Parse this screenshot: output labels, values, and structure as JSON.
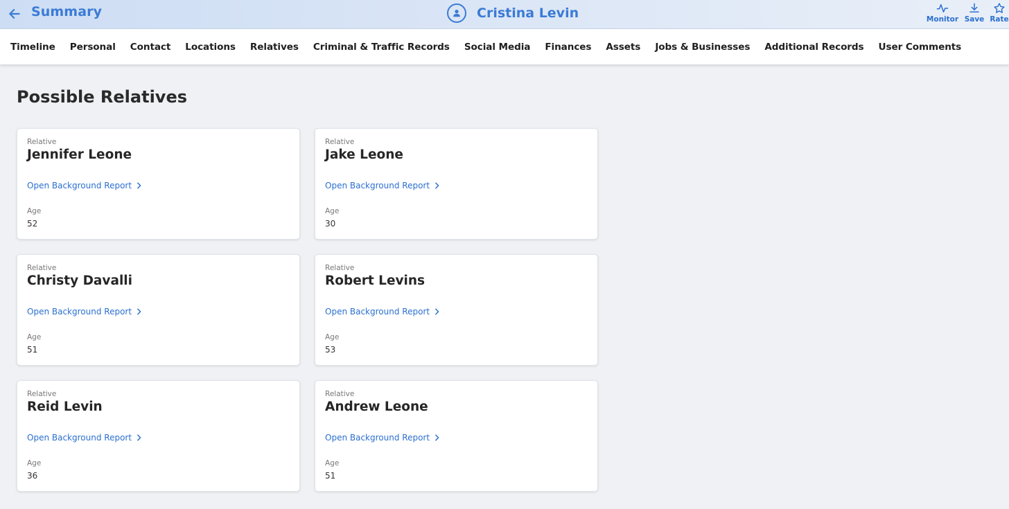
{
  "header": {
    "back_label": "Summary",
    "person_name": "Cristina Levin",
    "actions": [
      {
        "label": "Monitor",
        "icon": "activity-icon"
      },
      {
        "label": "Save",
        "icon": "download-icon"
      },
      {
        "label": "Rate",
        "icon": "star-icon"
      }
    ]
  },
  "tabs": [
    "Timeline",
    "Personal",
    "Contact",
    "Locations",
    "Relatives",
    "Criminal & Traffic Records",
    "Social Media",
    "Finances",
    "Assets",
    "Jobs & Businesses",
    "Additional Records",
    "User Comments"
  ],
  "section": {
    "title": "Possible Relatives",
    "relative_label": "Relative",
    "report_label": "Open Background Report",
    "age_label": "Age"
  },
  "relatives": [
    {
      "name": "Jennifer Leone",
      "age": "52"
    },
    {
      "name": "Jake Leone",
      "age": "30"
    },
    {
      "name": "Christy Davalli",
      "age": "51"
    },
    {
      "name": "Robert Levins",
      "age": "53"
    },
    {
      "name": "Reid Levin",
      "age": "36"
    },
    {
      "name": "Andrew Leone",
      "age": "51"
    }
  ],
  "colors": {
    "accent": "#2a6fcf",
    "header_bg": "#d4e2f5",
    "page_bg": "#eff1f4"
  }
}
